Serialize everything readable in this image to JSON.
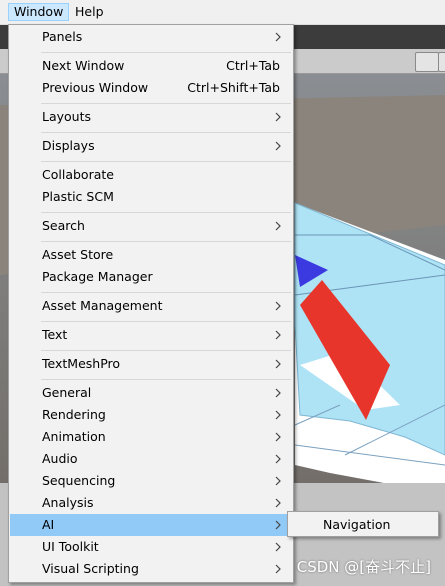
{
  "menubar": {
    "items": [
      {
        "label": "Window"
      },
      {
        "label": "Help"
      }
    ]
  },
  "window_menu": {
    "items": [
      {
        "label": "Panels"
      },
      {
        "label": "Next Window",
        "shortcut": "Ctrl+Tab"
      },
      {
        "label": "Previous Window",
        "shortcut": "Ctrl+Shift+Tab"
      },
      {
        "label": "Layouts"
      },
      {
        "label": "Displays"
      },
      {
        "label": "Collaborate"
      },
      {
        "label": "Plastic SCM"
      },
      {
        "label": "Search"
      },
      {
        "label": "Asset Store"
      },
      {
        "label": "Package Manager"
      },
      {
        "label": "Asset Management"
      },
      {
        "label": "Text"
      },
      {
        "label": "TextMeshPro"
      },
      {
        "label": "General"
      },
      {
        "label": "Rendering"
      },
      {
        "label": "Animation"
      },
      {
        "label": "Audio"
      },
      {
        "label": "Sequencing"
      },
      {
        "label": "Analysis"
      },
      {
        "label": "AI"
      },
      {
        "label": "UI Toolkit"
      },
      {
        "label": "Visual Scripting"
      }
    ]
  },
  "ai_submenu": {
    "items": [
      {
        "label": "Navigation"
      }
    ]
  },
  "watermark": "CSDN @[奋斗不止]",
  "colors": {
    "highlight": "#91c9f7",
    "menu_bg": "#f2f2f2",
    "menubar_active": "#cce8ff",
    "navmesh": "#aee3f5",
    "red_object": "#e8352b",
    "blue_object": "#3a3ae0"
  }
}
